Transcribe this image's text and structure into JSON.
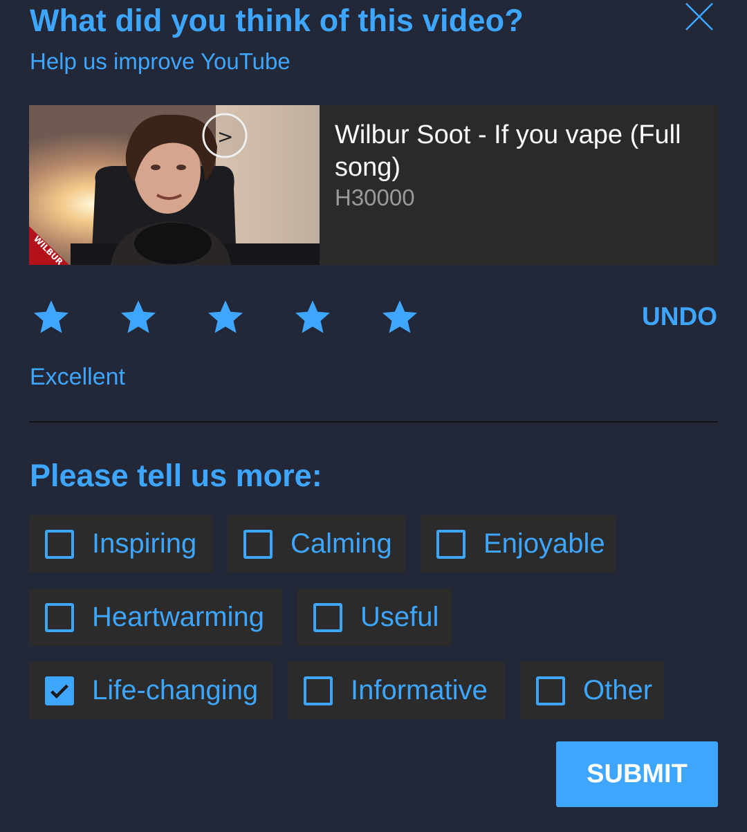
{
  "header": {
    "title": "What did you think of this video?",
    "subtitle": "Help us improve YouTube"
  },
  "video": {
    "title": "Wilbur Soot - If you vape (Full song)",
    "views": "H30000",
    "thumbnail_badge": "WILBUR"
  },
  "rating": {
    "value": 5,
    "max": 5,
    "label": "Excellent",
    "undo_label": "UNDO"
  },
  "feedback": {
    "heading": "Please tell us more:",
    "options": [
      {
        "label": "Inspiring",
        "checked": false
      },
      {
        "label": "Calming",
        "checked": false
      },
      {
        "label": "Enjoyable",
        "checked": false
      },
      {
        "label": "Heartwarming",
        "checked": false
      },
      {
        "label": "Useful",
        "checked": false
      },
      {
        "label": "Life-changing",
        "checked": true
      },
      {
        "label": "Informative",
        "checked": false
      },
      {
        "label": "Other",
        "checked": false
      }
    ]
  },
  "submit_label": "SUBMIT",
  "colors": {
    "background": "#232838",
    "accent": "#3ea6ff",
    "card": "#2b2b2b"
  }
}
